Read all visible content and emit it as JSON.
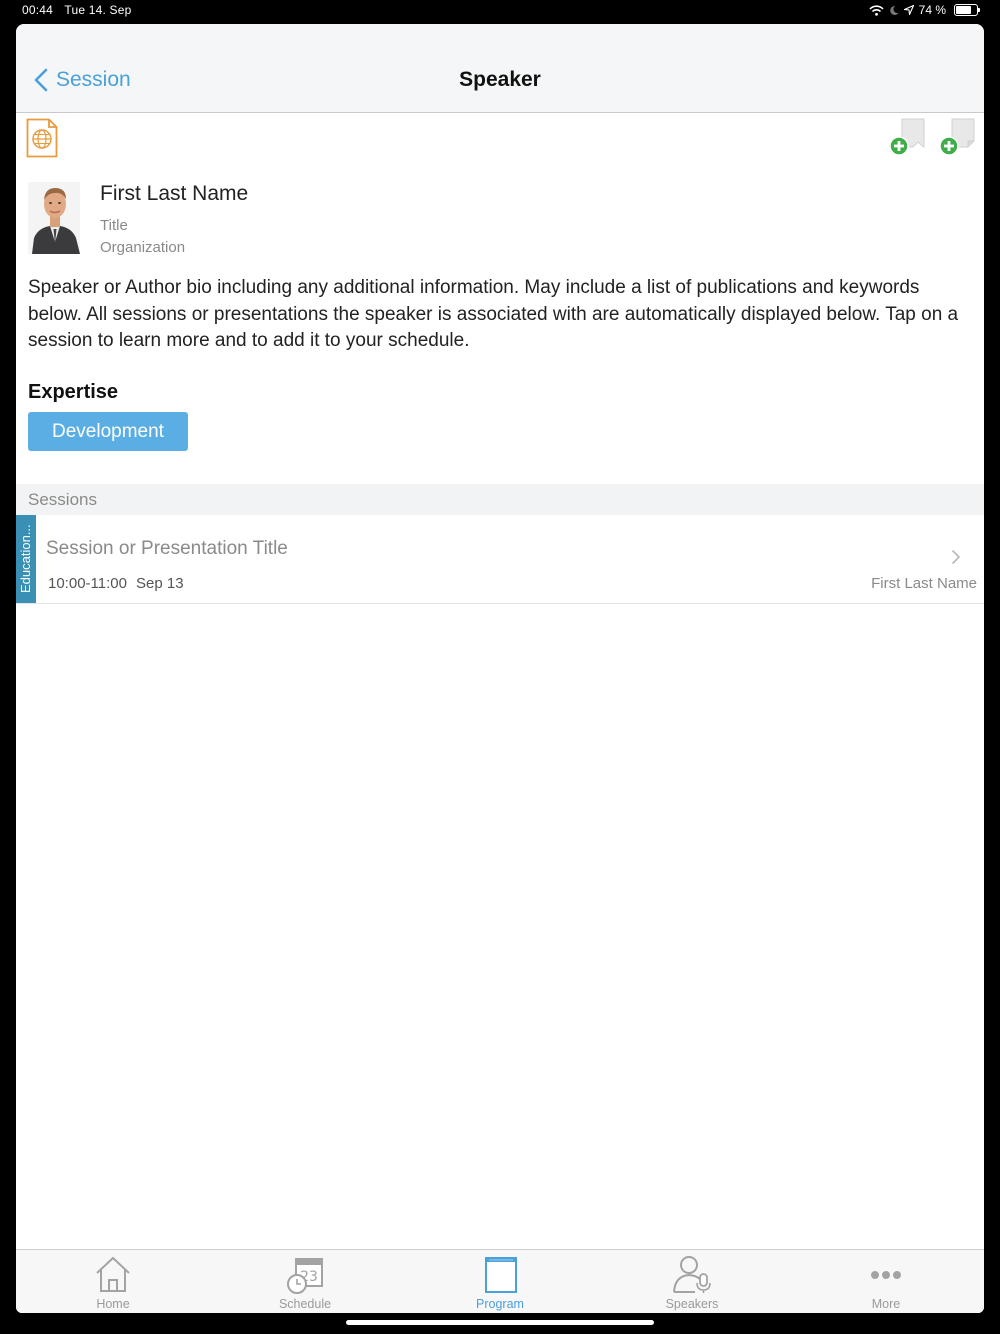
{
  "status_bar": {
    "time": "00:44",
    "date": "Tue 14. Sep",
    "battery": "74 %",
    "battery_level": 0.74
  },
  "navbar": {
    "back_label": "Session",
    "title": "Speaker"
  },
  "speaker": {
    "name": "First Last Name",
    "title": "Title",
    "organization": "Organization",
    "bio": "Speaker or Author bio including any additional information. May include a list of publications and keywords below. All sessions or presentations the speaker is associated with are automatically displayed below. Tap on a session to learn more and to add it to your schedule."
  },
  "expertise": {
    "heading": "Expertise",
    "tags": [
      "Development"
    ]
  },
  "sessions": {
    "header": "Sessions",
    "items": [
      {
        "track": "Education...",
        "title": "Session or Presentation Title",
        "time": "10:00-11:00",
        "date": "Sep 13",
        "speaker": "First Last Name",
        "track_color": "#3a8fb5"
      }
    ]
  },
  "tabbar": {
    "tabs": [
      {
        "label": "Home",
        "icon": "home-icon"
      },
      {
        "label": "Schedule",
        "icon": "schedule-icon",
        "calendar_day": "23"
      },
      {
        "label": "Program",
        "icon": "program-icon",
        "active": true
      },
      {
        "label": "Speakers",
        "icon": "speakers-icon"
      },
      {
        "label": "More",
        "icon": "more-icon"
      }
    ]
  },
  "colors": {
    "accent": "#4aa0d9",
    "tag": "#5aaee3",
    "track": "#3a8fb5",
    "add": "#3fae49",
    "web_icon": "#e89a3c"
  }
}
